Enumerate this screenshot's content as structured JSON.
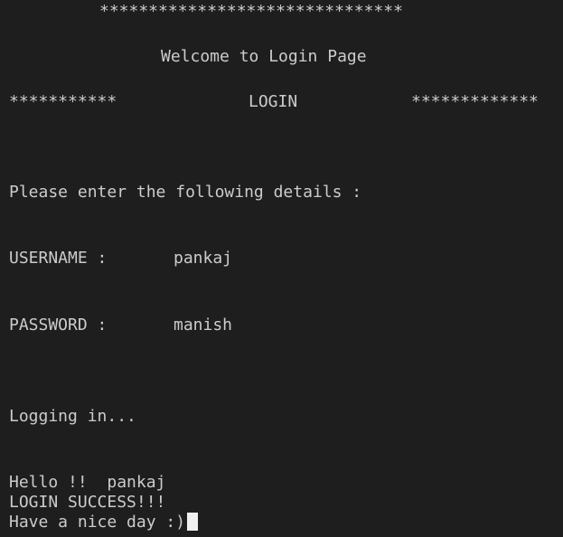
{
  "terminal": {
    "banner_top": "*******************************",
    "welcome": "Welcome to Login Page",
    "login_left_stars": "***********",
    "login_title": "LOGIN",
    "login_right_stars": "*************",
    "prompt": "Please enter the following details :",
    "username_label": "USERNAME :",
    "username_value": "pankaj",
    "password_label": "PASSWORD :",
    "password_value": "manish",
    "logging_in": "Logging in...",
    "hello_line": "Hello !!  pankaj",
    "success_line": "LOGIN SUCCESS!!!",
    "goodbye_line": "Have a nice day :)"
  },
  "colors": {
    "background": "#1e1e1e",
    "text": "#cccccc",
    "cursor": "#f0f0f0"
  }
}
